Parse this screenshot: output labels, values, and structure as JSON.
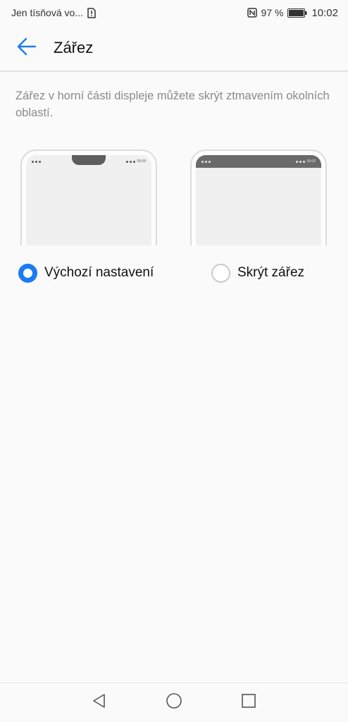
{
  "status_bar": {
    "carrier": "Jen tísňová vo...",
    "battery_percent": "97 %",
    "time": "10:02",
    "icons": [
      "sim-alert-icon",
      "nfc-icon",
      "battery-icon"
    ]
  },
  "app_bar": {
    "title": "Zářez",
    "back_icon": "arrow-back-icon"
  },
  "description": "Zářez v horní části displeje můžete skrýt ztmavením okolních oblastí.",
  "previews": [
    {
      "variant": "notch-default",
      "mini_time": "08:08"
    },
    {
      "variant": "notch-hidden",
      "mini_time": "08:08"
    }
  ],
  "options": [
    {
      "label": "Výchozí nastavení",
      "selected": true
    },
    {
      "label": "Skrýt zářez",
      "selected": false
    }
  ],
  "nav_bar": {
    "buttons": [
      "back-triangle-icon",
      "home-circle-icon",
      "recents-square-icon"
    ]
  },
  "colors": {
    "accent": "#1a7cf0",
    "background": "#fafafa",
    "description_text": "#8a8a8a"
  }
}
